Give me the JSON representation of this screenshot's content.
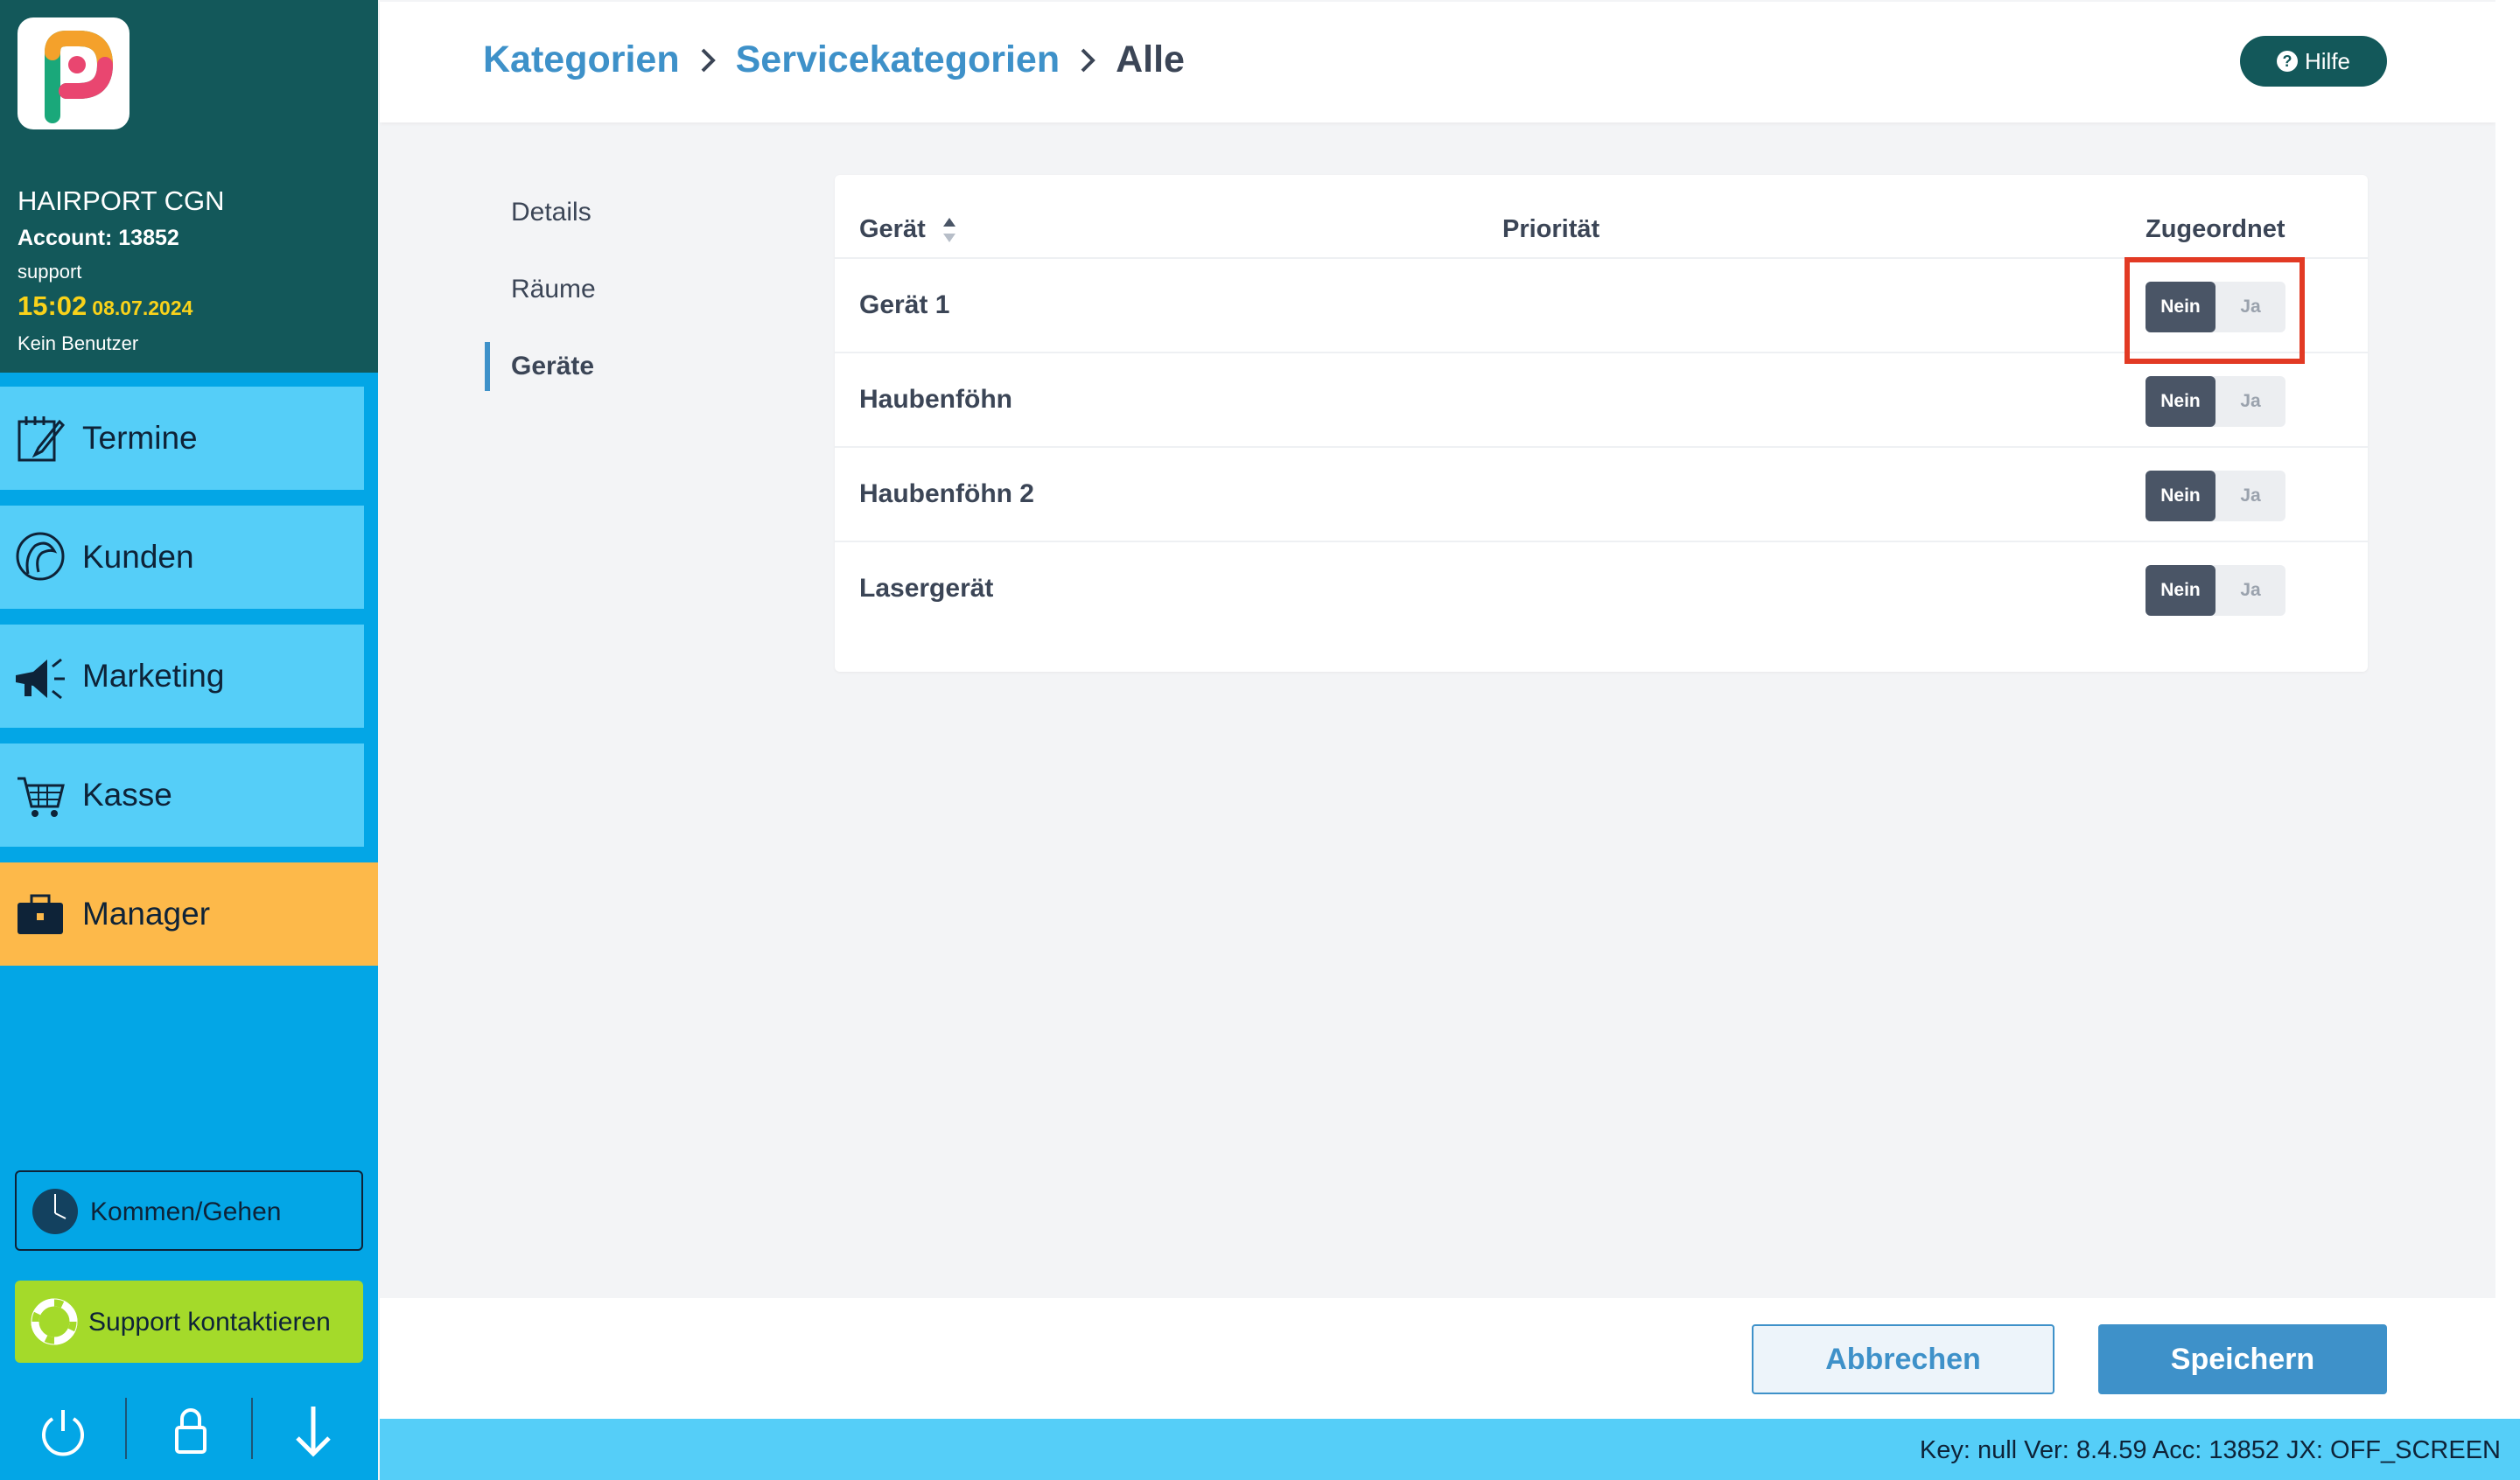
{
  "sidebar": {
    "studio_name": "HAIRPORT CGN",
    "account": "Account: 13852",
    "role": "support",
    "time": "15:02",
    "date": "08.07.2024",
    "user": "Kein Benutzer",
    "nav": [
      {
        "label": "Termine",
        "icon": "calendar-edit-icon"
      },
      {
        "label": "Kunden",
        "icon": "customer-head-icon"
      },
      {
        "label": "Marketing",
        "icon": "megaphone-icon"
      },
      {
        "label": "Kasse",
        "icon": "cart-icon"
      },
      {
        "label": "Manager",
        "icon": "briefcase-icon",
        "active": true
      }
    ],
    "kommen_gehen": "Kommen/Gehen",
    "support": "Support kontaktieren",
    "bottom_icons": [
      "power-icon",
      "lock-icon",
      "arrow-down-icon"
    ]
  },
  "header": {
    "breadcrumb": [
      "Kategorien",
      "Servicekategorien",
      "Alle"
    ],
    "help_label": "Hilfe"
  },
  "subnav": [
    {
      "label": "Details",
      "active": false
    },
    {
      "label": "Räume",
      "active": false
    },
    {
      "label": "Geräte",
      "active": true
    }
  ],
  "table": {
    "columns": [
      "Gerät",
      "Priorität",
      "Zugeordnet"
    ],
    "rows": [
      {
        "name": "Gerät 1",
        "assigned": "Nein"
      },
      {
        "name": "Haubenföhn",
        "assigned": "Nein"
      },
      {
        "name": "Haubenföhn 2",
        "assigned": "Nein"
      },
      {
        "name": "Lasergerät",
        "assigned": "Nein"
      }
    ],
    "toggle_labels": {
      "no": "Nein",
      "yes": "Ja"
    }
  },
  "footer": {
    "cancel_label": "Abbrechen",
    "save_label": "Speichern"
  },
  "status": "Key: null Ver: 8.4.59 Acc: 13852  JX: OFF_SCREEN",
  "colors": {
    "sidebar_header": "#13585a",
    "sidebar": "#03a6e6",
    "nav_item": "#55cef8",
    "manager_active": "#fdb94a",
    "support_button": "#a4da2a",
    "accent": "#3e91c9",
    "toggle_active": "#4a5566",
    "highlight": "#e23a24"
  }
}
